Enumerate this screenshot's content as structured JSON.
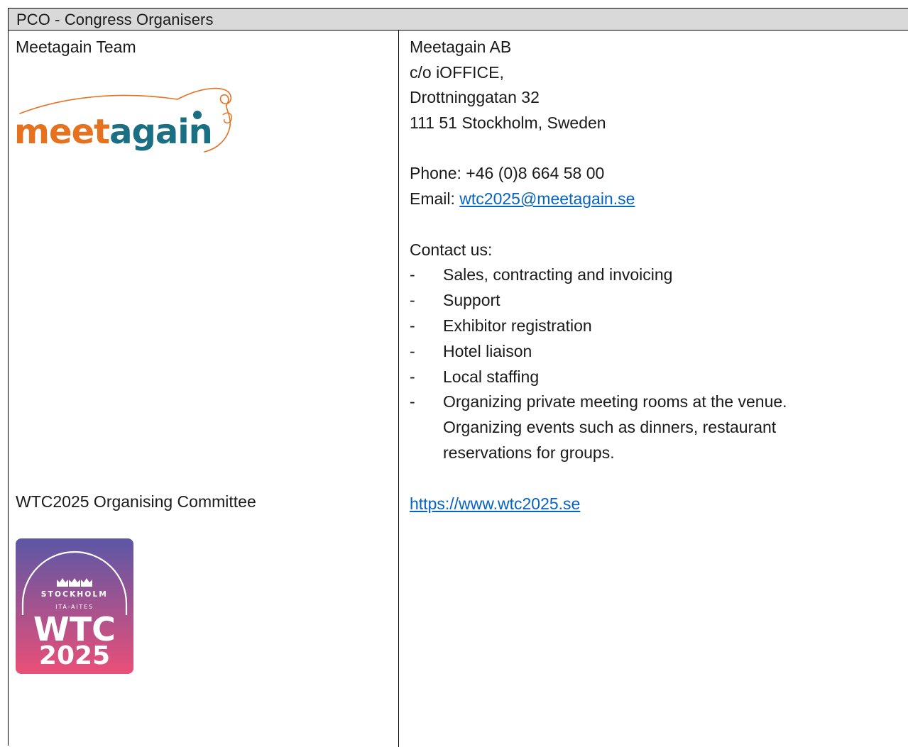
{
  "header": {
    "title": "PCO - Congress Organisers"
  },
  "left": {
    "team_title": "Meetagain Team",
    "meetagain_logo": {
      "icon": "meetagain-logo",
      "text_part1": "meet",
      "text_part2": "again",
      "colors": {
        "orange": "#e6711e",
        "teal": "#1a6f83"
      }
    },
    "committee_title": "WTC2025 Organising Committee",
    "wtc_logo": {
      "icon": "wtc2025-logo",
      "line1": "STOCKHOLM",
      "line2": "ITA-AITES",
      "line3": "WTC",
      "line4": "2025",
      "colors": {
        "top": "#5b57a6",
        "bottom": "#ea4f78"
      }
    }
  },
  "right": {
    "company": "Meetagain AB",
    "address1": "c/o iOFFICE,",
    "address2": "Drottninggatan 32",
    "address3": "111 51 Stockholm, Sweden",
    "phone": "Phone: +46 (0)8 664 58 00",
    "email_label": "Email: ",
    "email": "wtc2025@meetagain.se",
    "contact_heading": "Contact us:",
    "contact_items": [
      "Sales, contracting and invoicing",
      "Support",
      "Exhibitor registration",
      "Hotel liaison",
      "Local staffing",
      "Organizing private meeting rooms at the venue."
    ],
    "contact_continuation_1": "Organizing events such as dinners, restaurant",
    "contact_continuation_2": "reservations for groups.",
    "website": "https://www.wtc2025.se",
    "link_color": "#0563c1"
  }
}
